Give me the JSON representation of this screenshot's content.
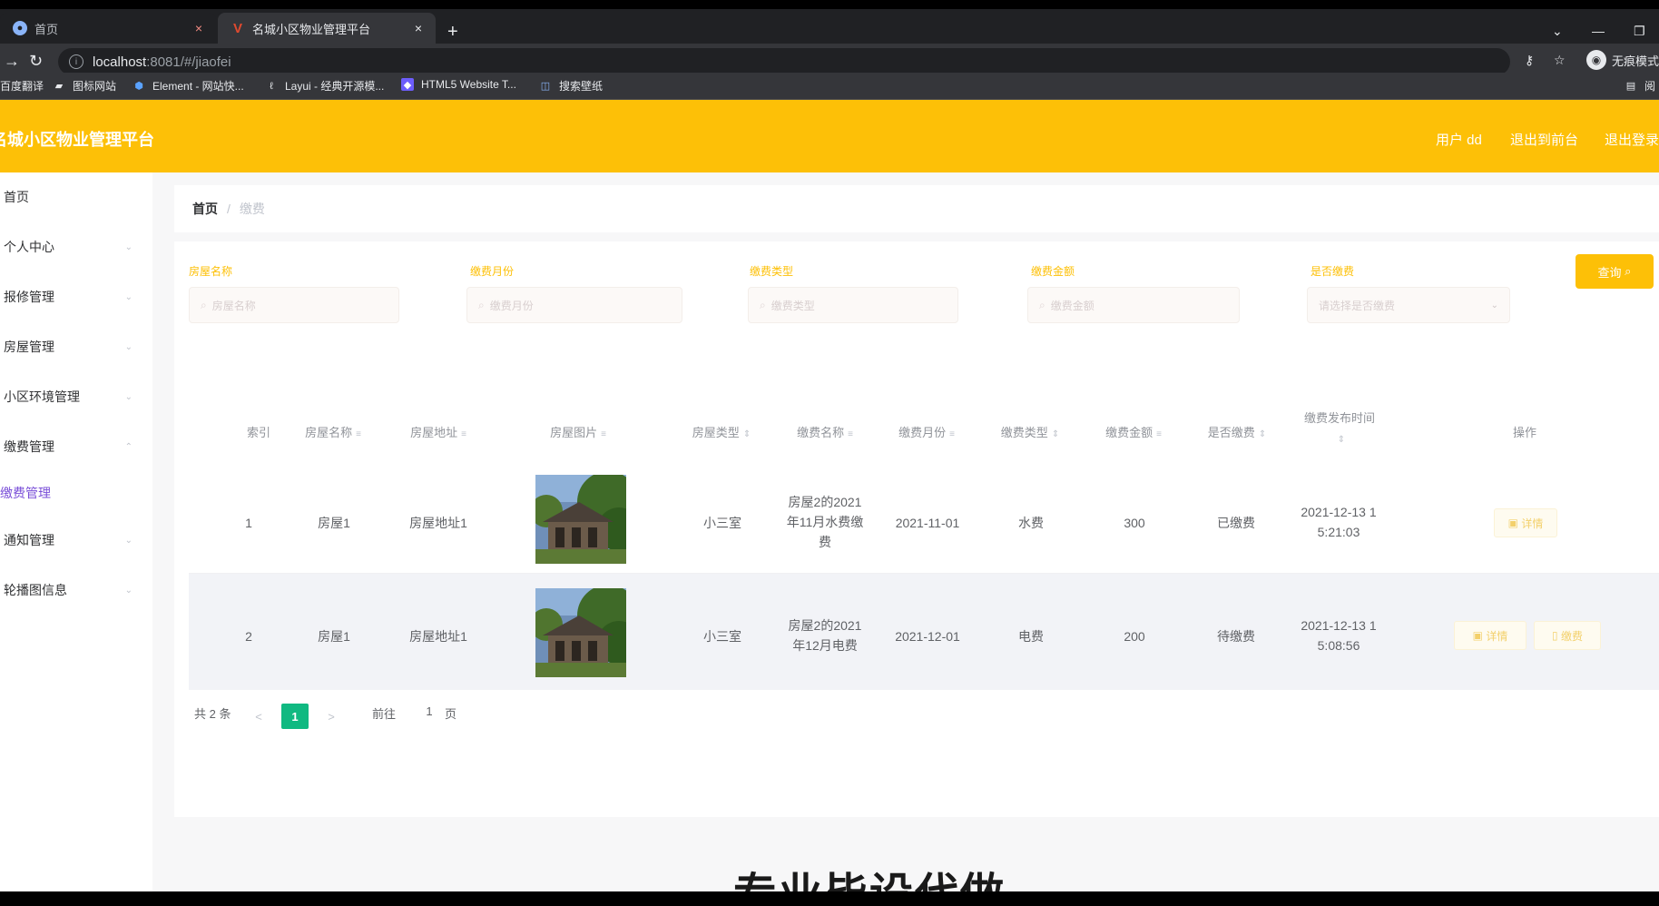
{
  "browser": {
    "tabs": [
      {
        "title": "首页",
        "close": "×"
      },
      {
        "title": "名城小区物业管理平台",
        "close": "×"
      }
    ],
    "new_tab": "+",
    "url_host": "localhost",
    "url_rest": ":8081/#/jiaofei",
    "incognito_label": "无痕模式",
    "bookmarks": [
      {
        "label": "百度翻译"
      },
      {
        "label": "图标网站"
      },
      {
        "label": "Element - 网站快..."
      },
      {
        "label": "Layui - 经典开源模..."
      },
      {
        "label": "HTML5 Website T..."
      },
      {
        "label": "搜索壁纸"
      },
      {
        "label": "阅"
      }
    ]
  },
  "header": {
    "brand": "名城小区物业管理平台",
    "user": "用户 dd",
    "to_front": "退出到前台",
    "logout": "退出登录"
  },
  "sidebar": {
    "items": [
      {
        "label": "首页"
      },
      {
        "label": "个人中心"
      },
      {
        "label": "报修管理"
      },
      {
        "label": "房屋管理"
      },
      {
        "label": "小区环境管理"
      },
      {
        "label": "缴费管理"
      },
      {
        "label": "缴费管理"
      },
      {
        "label": "通知管理"
      },
      {
        "label": "轮播图信息"
      }
    ]
  },
  "breadcrumb": {
    "home": "首页",
    "sep": "/",
    "current": "缴费"
  },
  "filters": {
    "labels": [
      "房屋名称",
      "缴费月份",
      "缴费类型",
      "缴费金额",
      "是否缴费"
    ],
    "placeholders": [
      "房屋名称",
      "缴费月份",
      "缴费类型",
      "缴费金额",
      "请选择是否缴费"
    ],
    "search": "查询"
  },
  "table": {
    "headers": [
      "索引",
      "房屋名称",
      "房屋地址",
      "房屋图片",
      "房屋类型",
      "缴费名称",
      "缴费月份",
      "缴费类型",
      "缴费金额",
      "是否缴费",
      "缴费发布时间",
      "操作"
    ],
    "rows": [
      {
        "index": "1",
        "house_name": "房屋1",
        "address": "房屋地址1",
        "type": "小三室",
        "fee_name": [
          "房屋2的2021",
          "年11月水费缴",
          "费"
        ],
        "month": "2021-11-01",
        "fee_type": "水费",
        "amount": "300",
        "paid": "已缴费",
        "time": [
          "2021-12-13 1",
          "5:21:03"
        ],
        "actions": [
          "详情"
        ]
      },
      {
        "index": "2",
        "house_name": "房屋1",
        "address": "房屋地址1",
        "type": "小三室",
        "fee_name": [
          "房屋2的2021",
          "年12月电费"
        ],
        "month": "2021-12-01",
        "fee_type": "电费",
        "amount": "200",
        "paid": "待缴费",
        "time": [
          "2021-12-13 1",
          "5:08:56"
        ],
        "actions": [
          "详情",
          "缴费"
        ]
      }
    ]
  },
  "pagination": {
    "total": "共 2 条",
    "prev": "<",
    "page": "1",
    "next": ">",
    "goto": "前往",
    "goto_value": "1",
    "unit": "页"
  },
  "watermark": "专业毕设代做",
  "colors": {
    "brand": "#fdc007",
    "active_page": "#10b981",
    "submenu_active": "#7a4fd8"
  }
}
